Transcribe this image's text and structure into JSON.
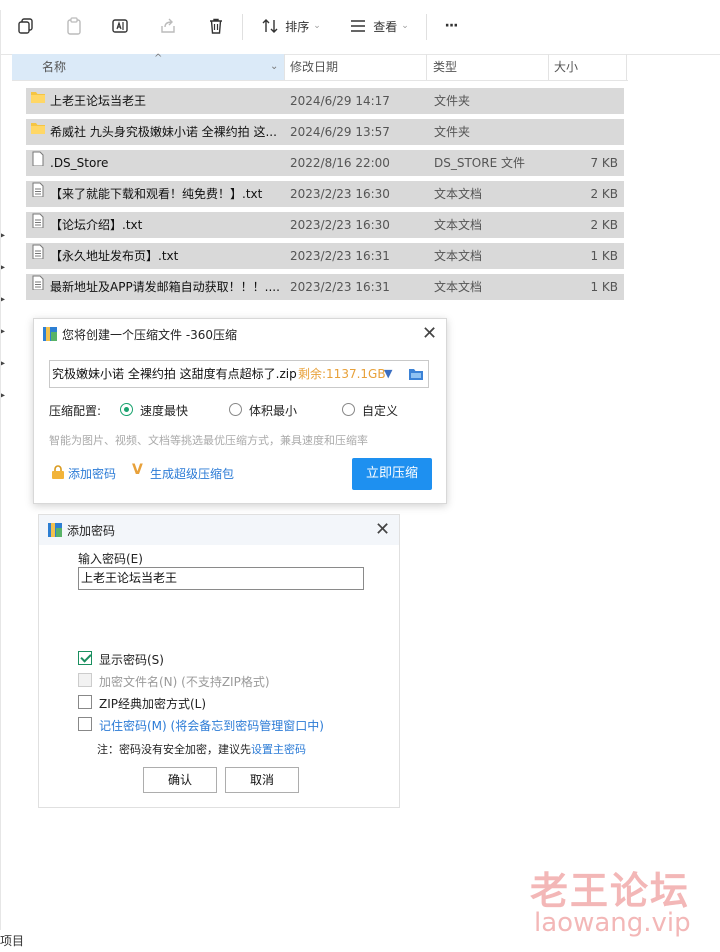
{
  "toolbar": {
    "sort_label": "排序",
    "view_label": "查看",
    "more_label": "···"
  },
  "columns": {
    "name": "名称",
    "date": "修改日期",
    "type": "类型",
    "size": "大小"
  },
  "files": [
    {
      "name": "上老王论坛当老王",
      "date": "2024/6/29 14:17",
      "type": "文件夹",
      "size": "",
      "icon": "folder-icon"
    },
    {
      "name": "希威社 九头身究极嫩妹小诺 全裸约拍 这...",
      "date": "2024/6/29 13:57",
      "type": "文件夹",
      "size": "",
      "icon": "folder-icon"
    },
    {
      "name": ".DS_Store",
      "date": "2022/8/16 22:00",
      "type": "DS_STORE 文件",
      "size": "7 KB",
      "icon": "file-icon"
    },
    {
      "name": "【来了就能下载和观看！纯免费！】.txt",
      "date": "2023/2/23 16:30",
      "type": "文本文档",
      "size": "2 KB",
      "icon": "text-file-icon"
    },
    {
      "name": "【论坛介绍】.txt",
      "date": "2023/2/23 16:30",
      "type": "文本文档",
      "size": "2 KB",
      "icon": "text-file-icon"
    },
    {
      "name": "【永久地址发布页】.txt",
      "date": "2023/2/23 16:31",
      "type": "文本文档",
      "size": "1 KB",
      "icon": "text-file-icon"
    },
    {
      "name": "最新地址及APP请发邮箱自动获取！！！....",
      "date": "2023/2/23 16:31",
      "type": "文本文档",
      "size": "1 KB",
      "icon": "text-file-icon"
    }
  ],
  "compress_dialog": {
    "title": "您将创建一个压缩文件 -360压缩",
    "path_value": "究极嫩妹小诺 全裸约拍 这甜度有点超标了.zip",
    "free_space": "剩余:1137.1GB",
    "config_label": "压缩配置:",
    "options": [
      "速度最快",
      "体积最小",
      "自定义"
    ],
    "selected_option": "速度最快",
    "hint": "智能为图片、视频、文档等挑选最优压缩方式，兼具速度和压缩率",
    "add_password": "添加密码",
    "super_package": "生成超级压缩包",
    "compress_now": "立即压缩"
  },
  "password_dialog": {
    "title": "添加密码",
    "input_label": "输入密码(E)",
    "password_value": "上老王论坛当老王",
    "show_password": "显示密码(S)",
    "show_password_checked": true,
    "encrypt_filenames": "加密文件名(N) (不支持ZIP格式)",
    "zip_classic": "ZIP经典加密方式(L)",
    "remember_password": "记住密码(M) (将会备忘到密码管理窗口中)",
    "note_prefix": "注：密码没有安全加密，建议先",
    "note_link": "设置主密码",
    "ok": "确认",
    "cancel": "取消"
  },
  "status": {
    "bottom_left": "项目"
  },
  "watermark": {
    "line1": "老王论坛",
    "line2": "laowang.vip"
  },
  "colors": {
    "row_bg": "#d9d9d9",
    "header_selected": "#dbeaf8",
    "primary_button": "#1e90f0",
    "radio_accent": "#1aa36f",
    "free_space": "#e8a13a",
    "link": "#2b7bd6",
    "watermark": "#f3b7b7"
  }
}
